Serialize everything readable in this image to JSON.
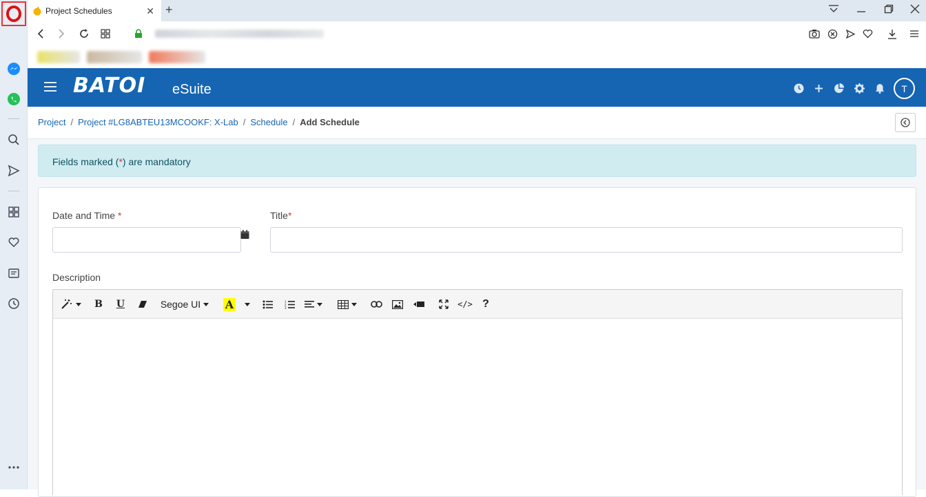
{
  "browser": {
    "tab_title": "Project Schedules",
    "tab_close": "✕",
    "new_tab": "+"
  },
  "app": {
    "logo": "BATOI",
    "logo_suffix": "eSuite",
    "avatar_initial": "T",
    "header_color": "#1565b3"
  },
  "breadcrumb": {
    "items": [
      "Project",
      "Project #LG8ABTEU13MCOOKF: X-Lab",
      "Schedule"
    ],
    "separator": "/",
    "current": "Add Schedule"
  },
  "alert": {
    "prefix": "Fields marked (",
    "marker": "*",
    "suffix": ") are mandatory"
  },
  "form": {
    "date_label": "Date and Time",
    "title_label": "Title",
    "required_marker": "*",
    "date_value": "",
    "title_value": "",
    "description_label": "Description"
  },
  "editor": {
    "font_name": "Segoe UI",
    "bold": "B",
    "underline": "U",
    "color": "A",
    "help": "?",
    "code": "</>",
    "highlight_color": "#ffff00"
  }
}
